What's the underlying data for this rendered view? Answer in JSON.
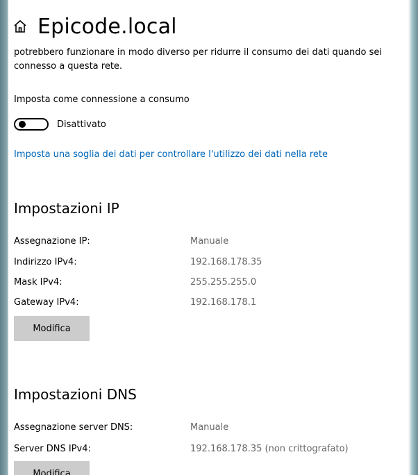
{
  "header": {
    "title": "Epicode.local",
    "home_icon": "home-icon"
  },
  "description": "potrebbero funzionare in modo diverso per ridurre il consumo dei dati quando sei connesso a questa rete.",
  "metered": {
    "label": "Imposta come connessione a consumo",
    "toggle_state": "Disattivato",
    "link": "Imposta una soglia dei dati per controllare l'utilizzo dei dati nella rete"
  },
  "ip_settings": {
    "heading": "Impostazioni IP",
    "rows": [
      {
        "label": "Assegnazione IP:",
        "value": "Manuale"
      },
      {
        "label": "Indirizzo IPv4:",
        "value": "192.168.178.35"
      },
      {
        "label": "Mask IPv4:",
        "value": "255.255.255.0"
      },
      {
        "label": "Gateway IPv4:",
        "value": "192.168.178.1"
      }
    ],
    "edit_button": "Modifica"
  },
  "dns_settings": {
    "heading": "Impostazioni DNS",
    "rows": [
      {
        "label": "Assegnazione server DNS:",
        "value": "Manuale"
      },
      {
        "label": "Server DNS IPv4:",
        "value": "192.168.178.35 (non crittografato)"
      }
    ],
    "edit_button": "Modifica"
  },
  "colors": {
    "link": "#0067b8",
    "button": "#cccccc",
    "value_text": "#666666"
  }
}
